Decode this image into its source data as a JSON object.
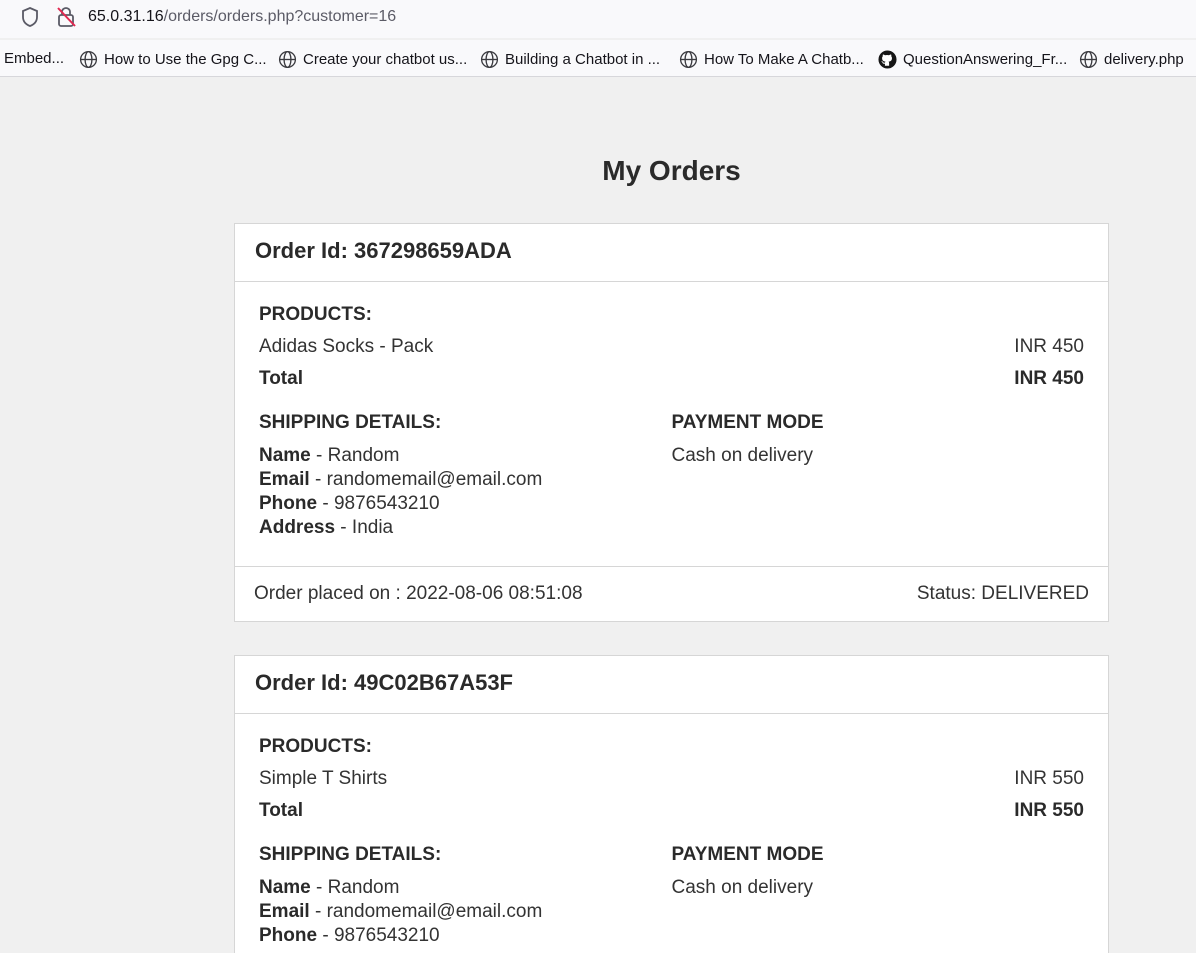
{
  "browser": {
    "url_host": "65.0.31.16",
    "url_path": "/orders/orders.php?customer=16",
    "bookmarks": [
      {
        "label": "Embed...",
        "icon": "none"
      },
      {
        "label": "How to Use the Gpg C...",
        "icon": "globe-icon"
      },
      {
        "label": "Create your chatbot us...",
        "icon": "globe-icon"
      },
      {
        "label": "Building a Chatbot in ...",
        "icon": "globe-icon"
      },
      {
        "label": "How To Make A Chatb...",
        "icon": "globe-icon"
      },
      {
        "label": "QuestionAnswering_Fr...",
        "icon": "github-icon"
      },
      {
        "label": "delivery.php",
        "icon": "globe-icon"
      }
    ]
  },
  "page": {
    "title": "My Orders"
  },
  "orders": [
    {
      "id_label": "Order Id: 367298659ADA",
      "products_title": "PRODUCTS:",
      "product_name": "Adidas Socks - Pack",
      "product_price": "INR 450",
      "total_label": "Total",
      "total_value": "INR 450",
      "shipping_title": "SHIPPING DETAILS:",
      "name_label": "Name",
      "name_value": " - Random",
      "email_label": "Email",
      "email_value": " - randomemail@email.com",
      "phone_label": "Phone",
      "phone_value": " - 9876543210",
      "address_label": "Address",
      "address_value": " - India",
      "payment_title": "PAYMENT MODE",
      "payment_value": "Cash on delivery",
      "placed_on": "Order placed on : 2022-08-06 08:51:08",
      "status": "Status: DELIVERED"
    },
    {
      "id_label": "Order Id: 49C02B67A53F",
      "products_title": "PRODUCTS:",
      "product_name": "Simple T Shirts",
      "product_price": "INR 550",
      "total_label": "Total",
      "total_value": "INR 550",
      "shipping_title": "SHIPPING DETAILS:",
      "name_label": "Name",
      "name_value": " - Random",
      "email_label": "Email",
      "email_value": " - randomemail@email.com",
      "phone_label": "Phone",
      "phone_value": " - 9876543210",
      "payment_title": "PAYMENT MODE",
      "payment_value": "Cash on delivery"
    }
  ],
  "colors": {
    "background": "#f0f0f0",
    "card": "#ffffff",
    "border": "#d6d6d6",
    "text": "#2a2a2a"
  }
}
